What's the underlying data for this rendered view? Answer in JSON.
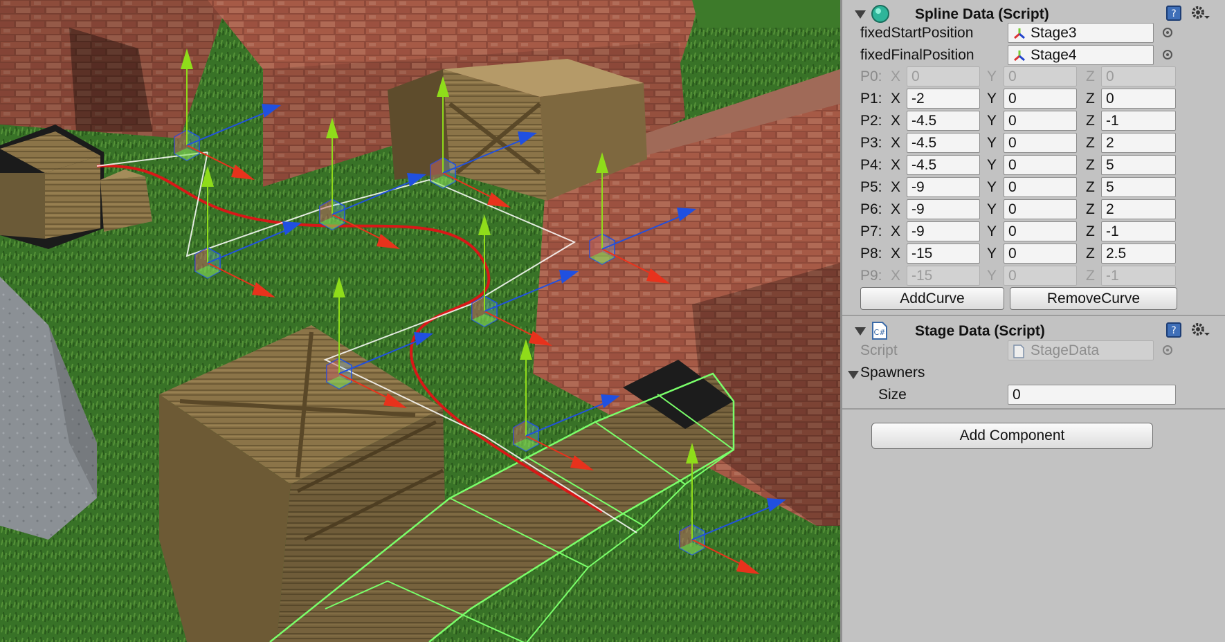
{
  "spline_component": {
    "title": "Spline Data (Script)",
    "fixed_start": {
      "label": "fixedStartPosition",
      "value": "Stage3"
    },
    "fixed_final": {
      "label": "fixedFinalPosition",
      "value": "Stage4"
    },
    "points": [
      {
        "label": "P0:",
        "x": "0",
        "y": "0",
        "z": "0",
        "disabled": true
      },
      {
        "label": "P1:",
        "x": "-2",
        "y": "0",
        "z": "0",
        "disabled": false
      },
      {
        "label": "P2:",
        "x": "-4.5",
        "y": "0",
        "z": "-1",
        "disabled": false
      },
      {
        "label": "P3:",
        "x": "-4.5",
        "y": "0",
        "z": "2",
        "disabled": false
      },
      {
        "label": "P4:",
        "x": "-4.5",
        "y": "0",
        "z": "5",
        "disabled": false
      },
      {
        "label": "P5:",
        "x": "-9",
        "y": "0",
        "z": "5",
        "disabled": false
      },
      {
        "label": "P6:",
        "x": "-9",
        "y": "0",
        "z": "2",
        "disabled": false
      },
      {
        "label": "P7:",
        "x": "-9",
        "y": "0",
        "z": "-1",
        "disabled": false
      },
      {
        "label": "P8:",
        "x": "-15",
        "y": "0",
        "z": "2.5",
        "disabled": false
      },
      {
        "label": "P9:",
        "x": "-15",
        "y": "0",
        "z": "-1",
        "disabled": true
      }
    ],
    "axis_labels": {
      "x": "X",
      "y": "Y",
      "z": "Z"
    },
    "add_curve": "AddCurve",
    "remove_curve": "RemoveCurve"
  },
  "stage_component": {
    "title": "Stage Data (Script)",
    "script_label": "Script",
    "script_value": "StageData",
    "spawners_label": "Spawners",
    "size_label": "Size",
    "size_value": "0"
  },
  "add_component": "Add Component",
  "icons": {
    "help": "help-book-icon",
    "settings": "gear-icon",
    "picker": "object-picker-icon",
    "transform": "transform-axes-icon",
    "script": "csharp-script-icon"
  },
  "colors": {
    "inspector_bg": "#c2c2c2",
    "grass": "#3f7a2c",
    "gizmo_x": "#e8321c",
    "gizmo_y": "#8fdc1a",
    "gizmo_z": "#2050e0",
    "spline": "#d81818"
  }
}
